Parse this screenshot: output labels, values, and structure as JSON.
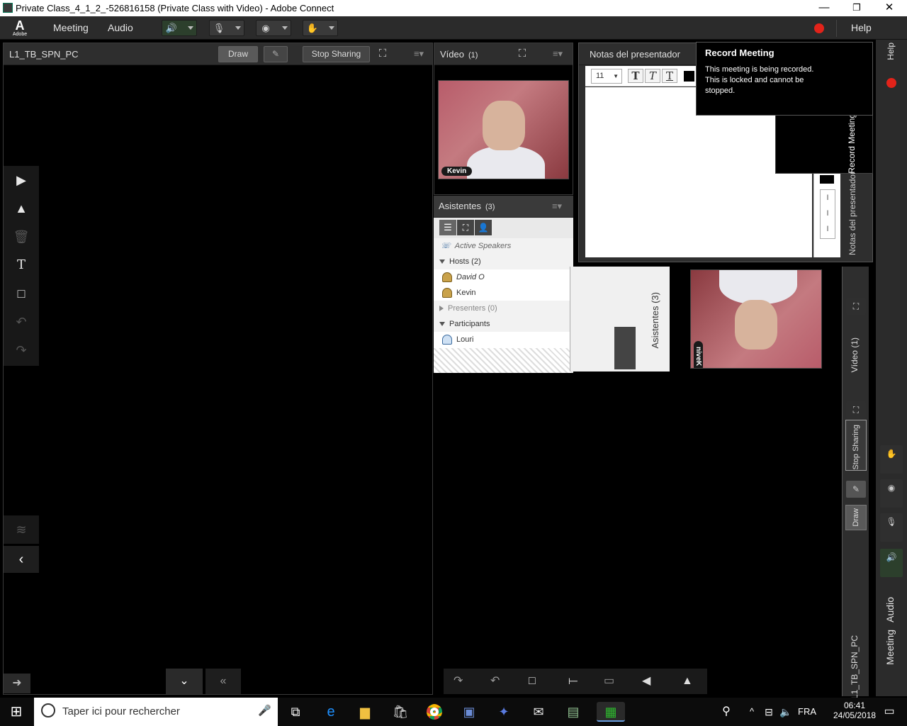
{
  "window": {
    "title": "Private Class_4_1_2_-526816158 (Private Class with Video) - Adobe Connect",
    "minimize": "—",
    "maximize": "❐",
    "close": "✕"
  },
  "menubar": {
    "logo_mark": "A",
    "logo_label": "Adobe",
    "menus": [
      "Meeting",
      "Audio"
    ],
    "speaker_icon": "speaker-icon",
    "mic_icon": "microphone-icon",
    "camera_icon": "webcam-icon",
    "status_icon": "raise-hand-icon",
    "help": "Help",
    "record_color": "#e2231a"
  },
  "share_pod": {
    "title": "L1_TB_SPN_PC",
    "draw_label": "Draw",
    "stop_sharing_label": "Stop Sharing",
    "tools": [
      "pointer-icon",
      "highlighter-icon",
      "trash-icon",
      "text-icon",
      "rectangle-icon",
      "undo-icon",
      "redo-icon"
    ]
  },
  "video_pod": {
    "title": "Vídeo",
    "count": "(1)",
    "participant_name": "Kevin"
  },
  "attendees_pod": {
    "title": "Asistentes",
    "count": "(3)",
    "active_speakers": "Active Speakers",
    "hosts_header": "Hosts (2)",
    "hosts": [
      "David O",
      "Kevin"
    ],
    "presenters_header": "Presenters (0)",
    "participants_header": "Participants",
    "participants": [
      "Louri"
    ]
  },
  "notes_pod": {
    "title": "Notas del presentador",
    "font_size": "11"
  },
  "record_popup": {
    "title": "Record Meeting",
    "message": "This meeting is being recorded. This is locked and cannot be stopped."
  },
  "mirror_texts": {
    "notes": "Notas del presentador",
    "record": "Record Meeting",
    "video": "Vídeo (1)",
    "attendees": "Asistentes (3)",
    "stop": "Stop Sharing",
    "draw": "Draw",
    "share": "L1_TB_SPN_PC",
    "help": "Help",
    "meeting": "Meeting",
    "audio": "Audio"
  },
  "taskbar": {
    "search_placeholder": "Taper ici pour rechercher",
    "language": "FRA",
    "time": "06:41",
    "date": "24/05/2018"
  },
  "colors": {
    "speaker_on": "#35c23b",
    "record": "#e2231a"
  }
}
